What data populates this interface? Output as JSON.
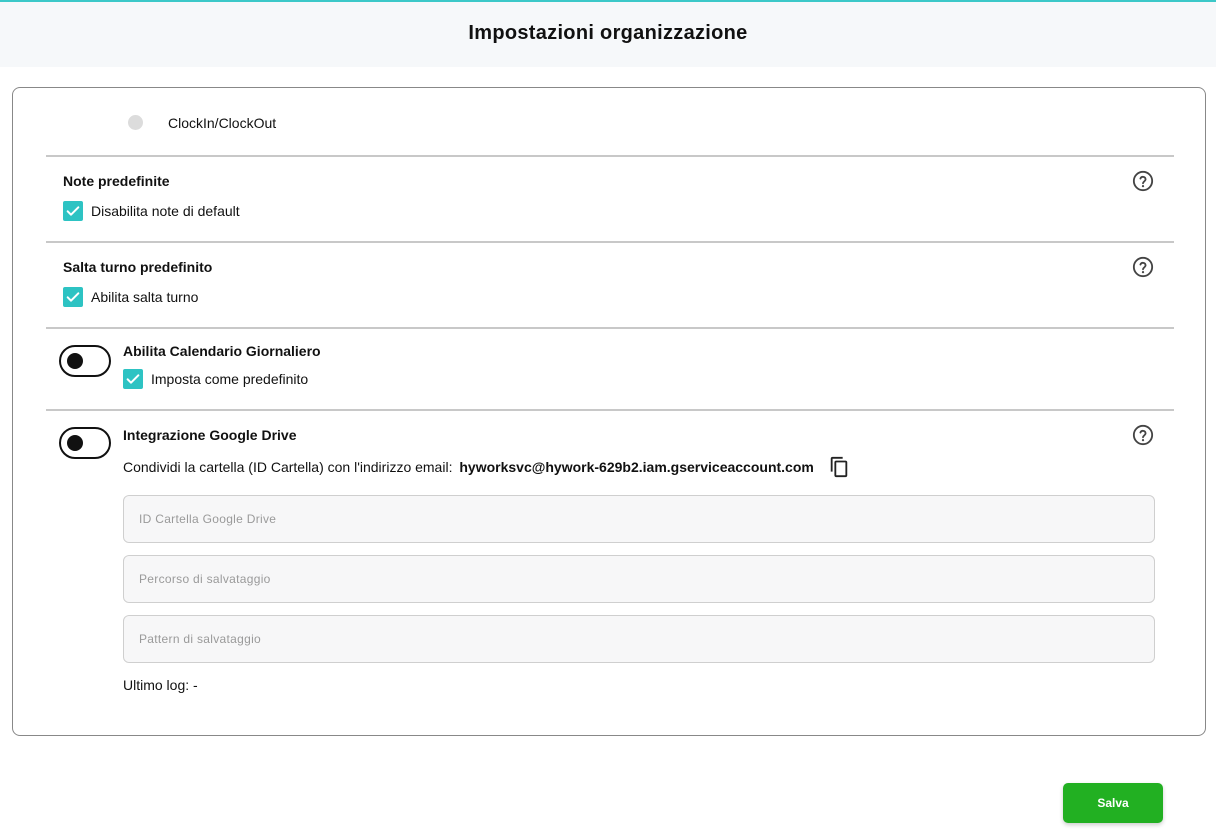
{
  "header": {
    "title": "Impostazioni organizzazione"
  },
  "clock": {
    "label": "ClockIn/ClockOut"
  },
  "notes": {
    "title": "Note predefinite",
    "checkbox_label": "Disabilita note di default",
    "checked": true
  },
  "skip_shift": {
    "title": "Salta turno predefinito",
    "checkbox_label": "Abilita salta turno",
    "checked": true
  },
  "daily_calendar": {
    "title": "Abilita Calendario Giornaliero",
    "enabled": false,
    "checkbox_label": "Imposta come predefinito",
    "checked": true
  },
  "google_drive": {
    "title": "Integrazione Google Drive",
    "enabled": false,
    "share_text": "Condividi la cartella (ID Cartella) con l'indirizzo email:",
    "email": "hyworksvc@hywork-629b2.iam.gserviceaccount.com",
    "folder_id": {
      "value": "",
      "placeholder": "ID Cartella Google Drive"
    },
    "save_path": {
      "value": "",
      "placeholder": "Percorso di salvataggio"
    },
    "save_pattern": {
      "value": "",
      "placeholder": "Pattern di salvataggio"
    },
    "last_log_label": "Ultimo log:",
    "last_log_value": "-"
  },
  "actions": {
    "save_label": "Salva"
  },
  "colors": {
    "accent": "#2dc3c3",
    "save": "#22b022",
    "header_bg": "#f6f8fa"
  },
  "icons": {
    "help": "help-circle-icon",
    "copy": "copy-icon",
    "check": "check-icon"
  }
}
